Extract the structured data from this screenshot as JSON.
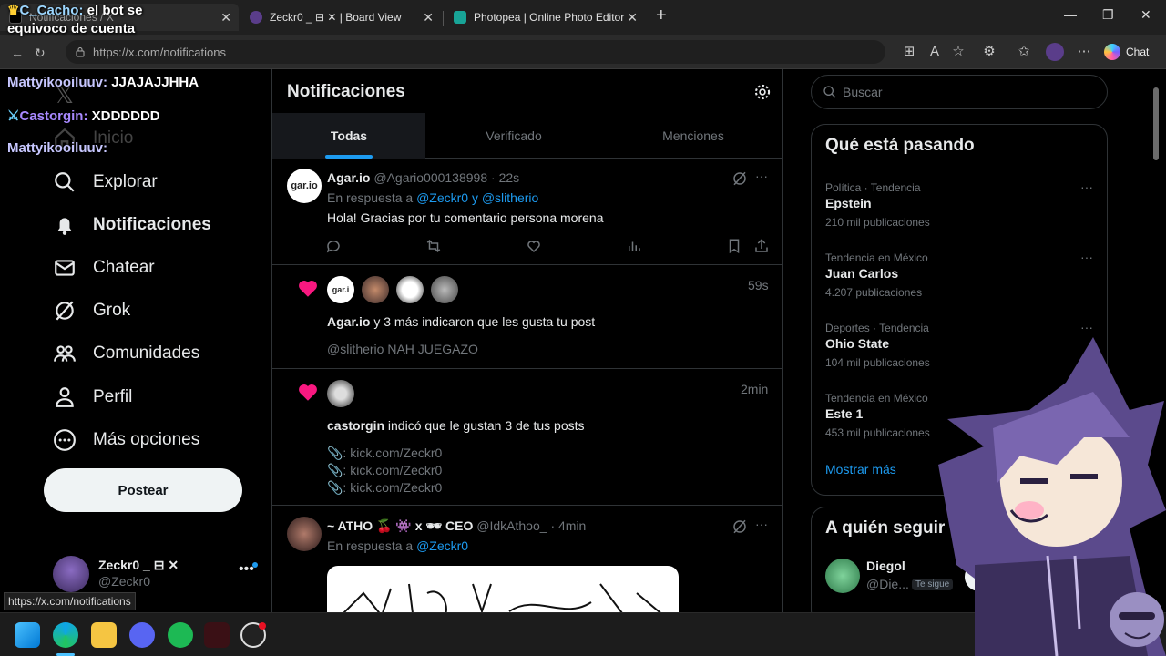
{
  "browser": {
    "tabs": [
      {
        "title": "Notificaciones / X"
      },
      {
        "title": "Zeckr0 _ ⊟ ✕ | Board View"
      },
      {
        "title": "Photopea | Online Photo Editor"
      }
    ],
    "url": "https://x.com/notifications",
    "chat_label": "Chat",
    "status_url": "https://x.com/notifications"
  },
  "overlay": {
    "msg1_user": "C_Cacho:",
    "msg1_text_a": "el bot se",
    "msg1_text_b": "equivoco de cuenta",
    "msg2_user": "Mattyikooiluuv:",
    "msg2_text": "JJAJAJJHHA",
    "msg3_user": "Castorgin:",
    "msg3_text": "XDDDDDD",
    "msg4_user": "Mattyikooiluuv:"
  },
  "nav": {
    "home": "Inicio",
    "explore": "Explorar",
    "notifications": "Notificaciones",
    "chat": "Chatear",
    "grok": "Grok",
    "communities": "Comunidades",
    "profile": "Perfil",
    "more": "Más opciones",
    "post": "Postear"
  },
  "profile": {
    "name": "Zeckr0 _ ⊟ ✕",
    "handle": "@Zeckr0"
  },
  "center": {
    "title": "Notificaciones",
    "tabs": [
      "Todas",
      "Verificado",
      "Menciones"
    ],
    "n1": {
      "name": "Agar.io",
      "handle": "@Agario000138998",
      "time": "· 22s",
      "reply_prefix": "En respuesta a",
      "reply_to_1": "@Zeckr0",
      "reply_and": "y",
      "reply_to_2": "@slitherio",
      "text": "Hola! Gracias por tu comentario persona morena"
    },
    "n2": {
      "time": "59s",
      "actor": "Agar.io",
      "text": "y 3 más indicaron que les gusta tu post",
      "quote": "@slitherio NAH JUEGAZO"
    },
    "n3": {
      "time": "2min",
      "actor": "castorgin",
      "text": "indicó que le gustan 3 de tus posts",
      "links": [
        "📎: kick.com/Zeckr0",
        "📎: kick.com/Zeckr0",
        "📎: kick.com/Zeckr0"
      ]
    },
    "n4": {
      "name": "~ ATHO 🍒 👾 x 🕶 CEO",
      "handle": "@IdkAthoo_",
      "time": "· 4min",
      "reply_prefix": "En respuesta a",
      "reply_to": "@Zeckr0"
    }
  },
  "right": {
    "search_placeholder": "Buscar",
    "trends_title": "Qué está pasando",
    "trends": [
      {
        "context": "Política · Tendencia",
        "title": "Epstein",
        "count": "210 mil publicaciones"
      },
      {
        "context": "Tendencia en México",
        "title": "Juan Carlos",
        "count": "4.207 publicaciones"
      },
      {
        "context": "Deportes · Tendencia",
        "title": "Ohio State",
        "count": "104 mil publicaciones"
      },
      {
        "context": "Tendencia en México",
        "title": "Este 1",
        "count": "453 mil publicaciones"
      }
    ],
    "show_more": "Mostrar más",
    "follow_title": "A quién seguir",
    "follow_name": "Diegol",
    "follow_handle": "@Die...",
    "follow_badge": "Te sigue",
    "follow_button": "Se"
  },
  "colors": {
    "accent": "#1d9bf0",
    "like": "#f91880",
    "bg": "#000000"
  }
}
